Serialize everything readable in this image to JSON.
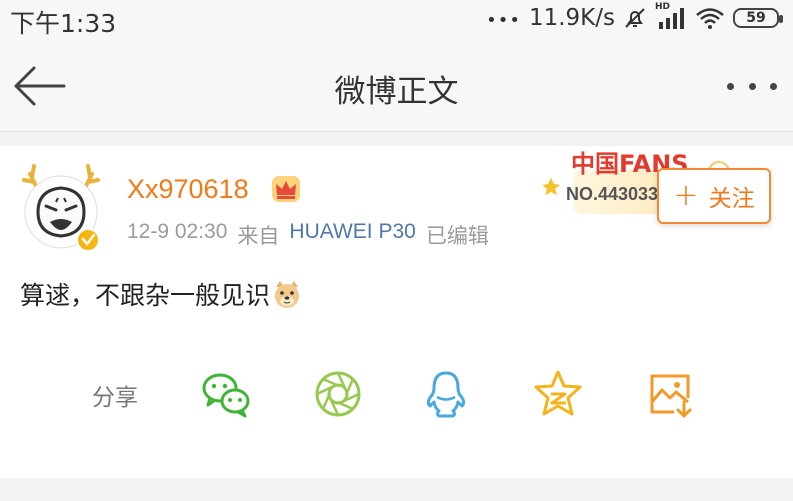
{
  "status_bar": {
    "time": "下午1:33",
    "dots": "•••",
    "network_speed": "11.9K/s",
    "signal_label": "HD",
    "battery": "59"
  },
  "nav": {
    "title": "微博正文"
  },
  "post": {
    "username": "Xx970618",
    "date": "12-9 02:30",
    "source_prefix": "来自",
    "source_app": "HUAWEI P30",
    "edited_label": "已编辑",
    "fans_badge_text": "中国FANS",
    "fans_number": "NO.443033",
    "follow_label": "关注",
    "follow_plus": "+",
    "content": "算逑，不跟杂一般见识"
  },
  "share": {
    "label": "分享",
    "targets": [
      "wechat",
      "moments",
      "qq",
      "qzone",
      "save-image"
    ]
  },
  "colors": {
    "username": "#f07a1a",
    "source_app": "#5079a8",
    "wechat": "#3fb535",
    "moments": "#97c84f",
    "qq": "#4aa8e0",
    "qzone": "#f4b31c",
    "save_image": "#f09a2a"
  }
}
